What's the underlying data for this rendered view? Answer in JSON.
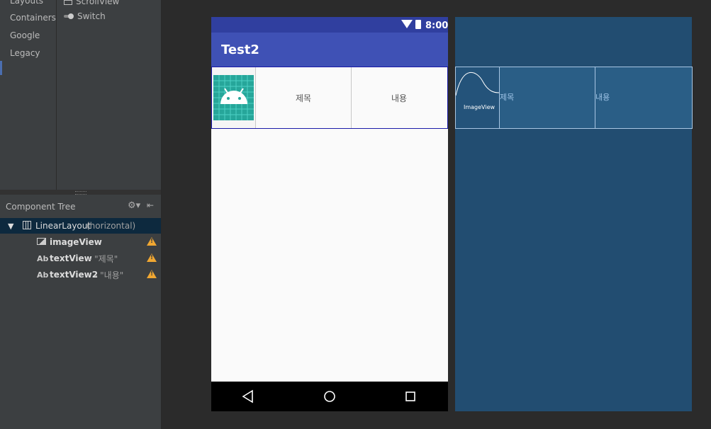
{
  "palette": {
    "categories": [
      "Layouts",
      "Containers",
      "Google",
      "Legacy"
    ],
    "items": [
      "ScrollView",
      "Switch"
    ]
  },
  "component_tree": {
    "title": "Component Tree",
    "nodes": [
      {
        "name": "LinearLayout",
        "detail": "(horizontal)"
      },
      {
        "name": "imageView",
        "detail": ""
      },
      {
        "name": "textView",
        "detail": "- \"제목\""
      },
      {
        "name": "textView2",
        "detail": "- \"내용\""
      }
    ],
    "text_prefix": "Ab"
  },
  "device": {
    "time": "8:00",
    "app_title": "Test2",
    "text1": "제목",
    "text2": "내용"
  },
  "blueprint": {
    "image_label": "ImageView",
    "text1": "제목",
    "text2": "내용"
  },
  "colors": {
    "primary": "#3f51b5",
    "primary_dark": "#303f9f",
    "blueprint_bg": "#224d71",
    "warning": "#f0a732"
  }
}
